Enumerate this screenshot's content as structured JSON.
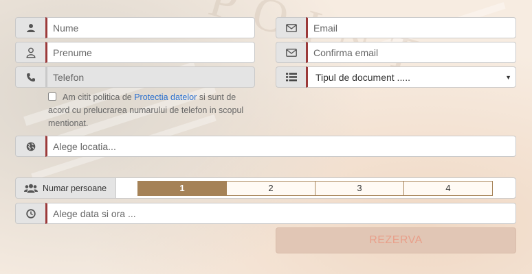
{
  "form": {
    "name_placeholder": "Nume",
    "surname_placeholder": "Prenume",
    "phone_placeholder": "Telefon",
    "email_placeholder": "Email",
    "confirm_email_placeholder": "Confirma email",
    "document_type_selected": "Tipul de document .....",
    "consent": {
      "text_before": "Am citit politica de ",
      "link_text": "Protectia datelor",
      "text_after": " si sunt de acord cu prelucrarea numarului de telefon in scopul mentionat.",
      "checked": false
    },
    "location_placeholder": "Alege locatia...",
    "persons": {
      "label": "Numar persoane",
      "options": [
        "1",
        "2",
        "3",
        "4"
      ],
      "selected": "1"
    },
    "datetime_placeholder": "Alege data si ora ...",
    "submit_label": "REZERVA"
  },
  "icons": {
    "name": "user-icon",
    "surname": "user-outline-icon",
    "phone": "phone-icon",
    "email": "envelope-icon",
    "confirm_email": "envelope-icon",
    "document_type": "list-icon",
    "location": "globe-icon",
    "persons": "users-icon",
    "datetime": "clock-icon"
  },
  "colors": {
    "field_accent": "#9b3a3a",
    "selected_option": "#a58257",
    "submit_background": "#e1c6b5",
    "submit_text": "#e89f8a",
    "link": "#2a6fce"
  }
}
